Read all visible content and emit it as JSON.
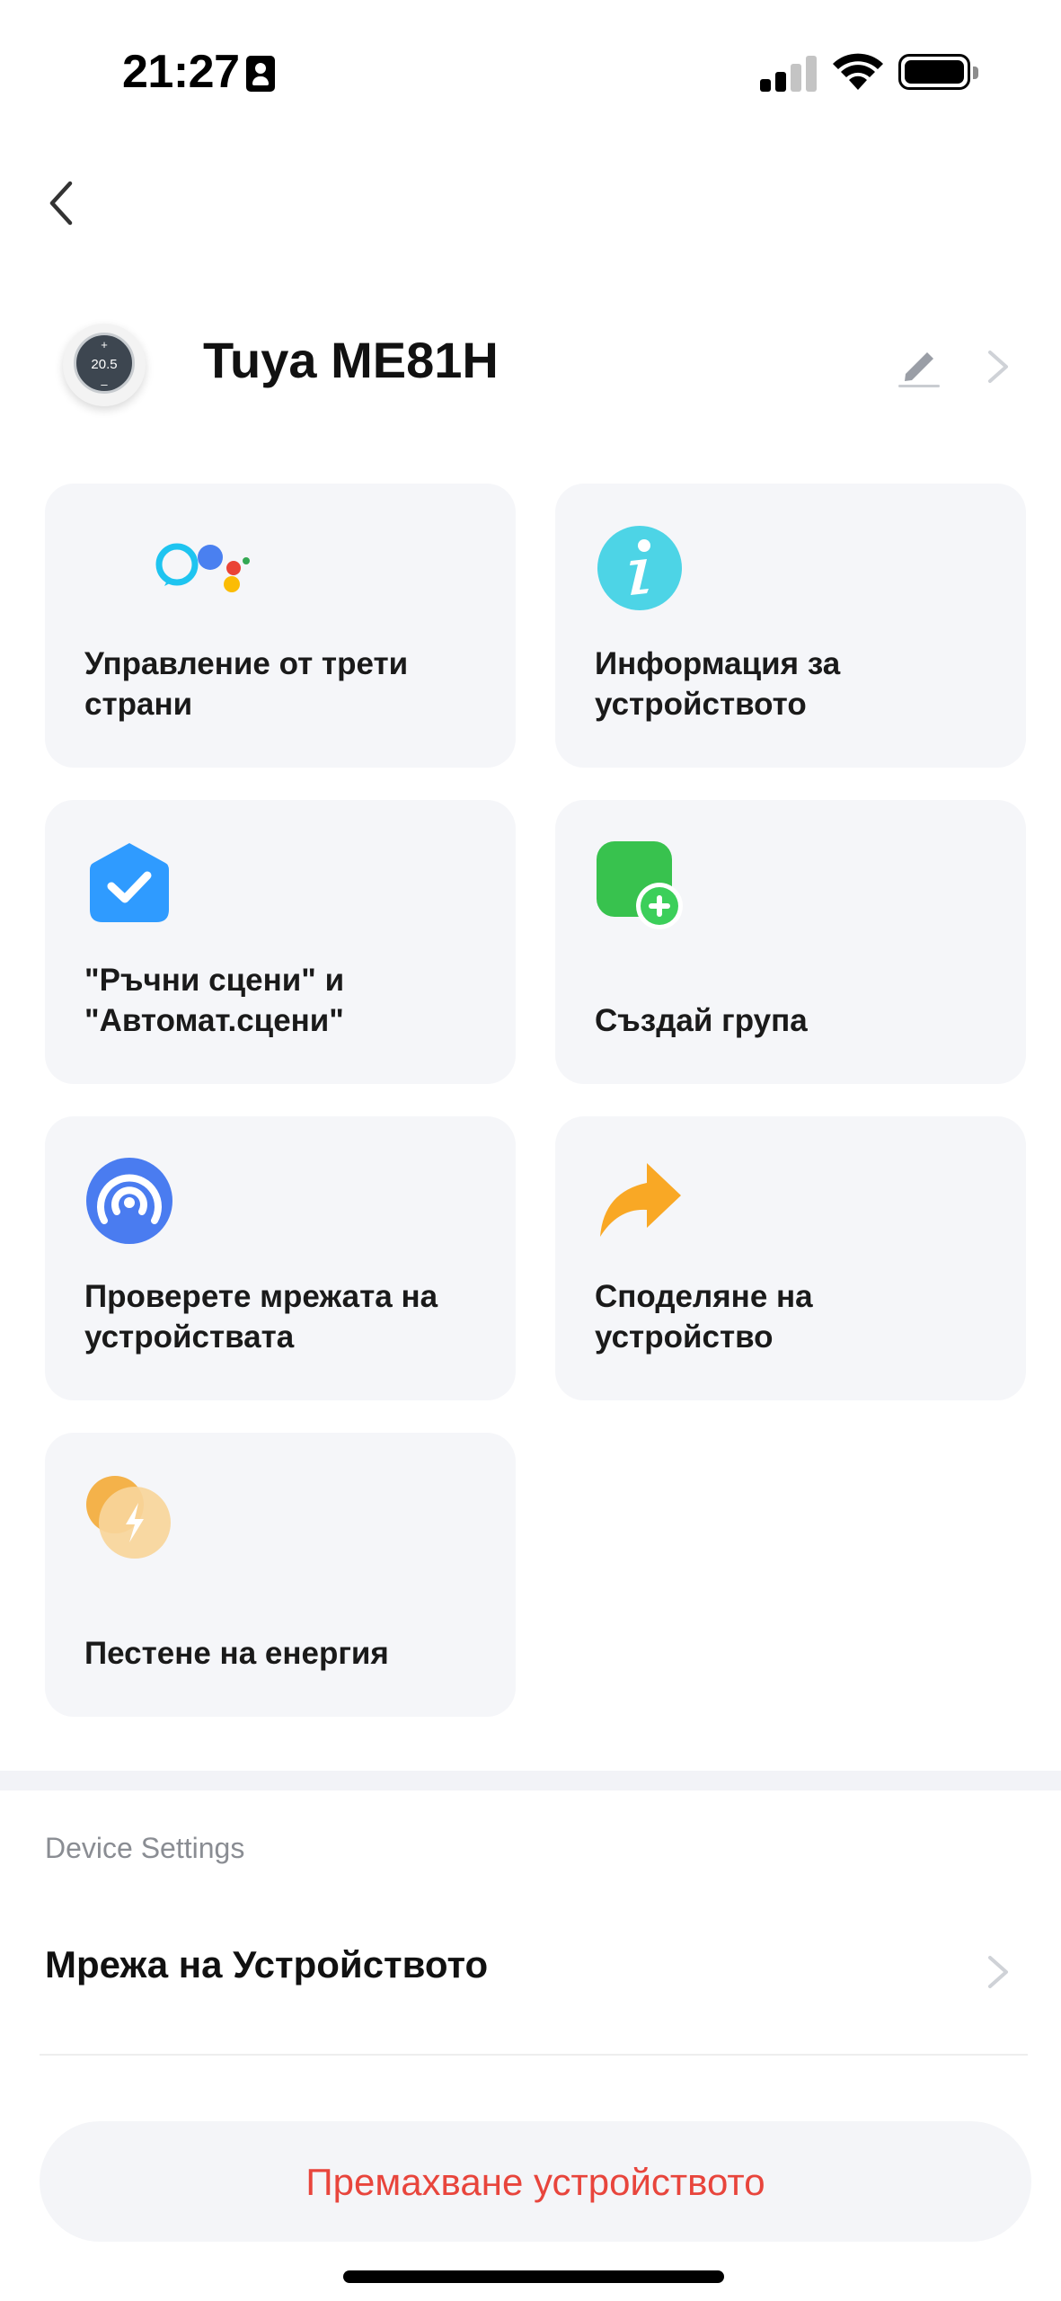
{
  "status_bar": {
    "time": "21:27",
    "icons": [
      "contact-card-icon",
      "cellular-signal-icon",
      "wifi-icon",
      "battery-icon"
    ],
    "signal_bars_active": 2,
    "battery_level": 0.9
  },
  "nav": {
    "back_icon": "chevron-left-icon"
  },
  "device": {
    "name": "Tuya ME81H",
    "thumb_display": "20.5",
    "icons": [
      "edit-pencil-icon",
      "chevron-right-icon"
    ]
  },
  "tiles": [
    {
      "label": "Управление от трети\nстрани",
      "icon": "alexa-google-assistant-icon"
    },
    {
      "label": "Информация за\nустройството",
      "icon": "info-icon"
    },
    {
      "label": "\"Ръчни сцени\" и\n\"Автомат.сцени\"",
      "icon": "scene-check-icon"
    },
    {
      "label": "Създай група",
      "icon": "add-group-icon"
    },
    {
      "label": "Проверете мрежата на\nустройствата",
      "icon": "network-check-icon"
    },
    {
      "label": "Споделяне на\nустройство",
      "icon": "share-arrow-icon"
    },
    {
      "label": "Пестене на енергия",
      "icon": "energy-saving-icon"
    }
  ],
  "device_settings": {
    "section_title": "Device Settings",
    "rows": [
      {
        "label": "Мрежа на Устройството"
      }
    ]
  },
  "remove_button": {
    "label": "Премахване устройството"
  },
  "colors": {
    "accent_red": "#e8453c",
    "tile_bg": "#f5f6f9",
    "info_cyan": "#4dd4e6",
    "scene_blue": "#2f9bff",
    "group_green": "#38c24e",
    "network_blue": "#4a7cf0",
    "share_orange": "#f9a825",
    "energy_amber": "#f4b24a"
  }
}
